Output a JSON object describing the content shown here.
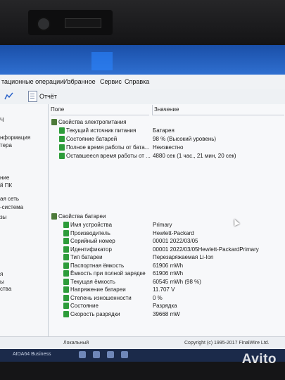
{
  "menu": [
    "тационные операции",
    "Избранное",
    "Сервис",
    "Справка"
  ],
  "toolbar": {
    "report_label": "Отчёт"
  },
  "sidebar": [
    "Ч",
    "нформация",
    "тера",
    "ние",
    "й ПК",
    "ая сеть",
    "-система",
    "зы",
    "я",
    "ы",
    "ства"
  ],
  "table": {
    "col_field": "Поле",
    "col_value": "Значение",
    "group1": "Свойства электропитания",
    "rows1": [
      {
        "f": "Текущий источник питания",
        "v": "Батарея"
      },
      {
        "f": "Состояние батарей",
        "v": "98 % (Высокий уровень)"
      },
      {
        "f": "Полное время работы от бата...",
        "v": "Неизвестно"
      },
      {
        "f": "Оставшееся время работы от ...",
        "v": "4880 сек (1 час., 21 мин, 20 сек)"
      }
    ],
    "group2": "Свойства батареи",
    "rows2": [
      {
        "f": "Имя устройства",
        "v": "Primary"
      },
      {
        "f": "Производитель",
        "v": "Hewlett-Packard"
      },
      {
        "f": "Серийный номер",
        "v": "00001 2022/03/05"
      },
      {
        "f": "Идентификатор",
        "v": "00001 2022/03/05Hewlett-PackardPrimary"
      },
      {
        "f": "Тип батареи",
        "v": "Перезаряжаемая Li-Ion"
      },
      {
        "f": "Паспортная ёмкость",
        "v": "61906 mWh"
      },
      {
        "f": "Ёмкость при полной зарядке",
        "v": "61906 mWh"
      },
      {
        "f": "Текущая ёмкость",
        "v": "60545 mWh  (98 %)"
      },
      {
        "f": "Напряжение батареи",
        "v": "11.707 V"
      },
      {
        "f": "Степень изношенности",
        "v": "0 %"
      },
      {
        "f": "Состояние",
        "v": "Разрядка"
      },
      {
        "f": "Скорость разрядки",
        "v": "39668 mW"
      }
    ]
  },
  "status": {
    "left": "Локальный",
    "right": "Copyright (c) 1995-2017 FinalWire Ltd."
  },
  "taskbar": {
    "app": "AIDA64 Business"
  },
  "watermark": "Avito"
}
